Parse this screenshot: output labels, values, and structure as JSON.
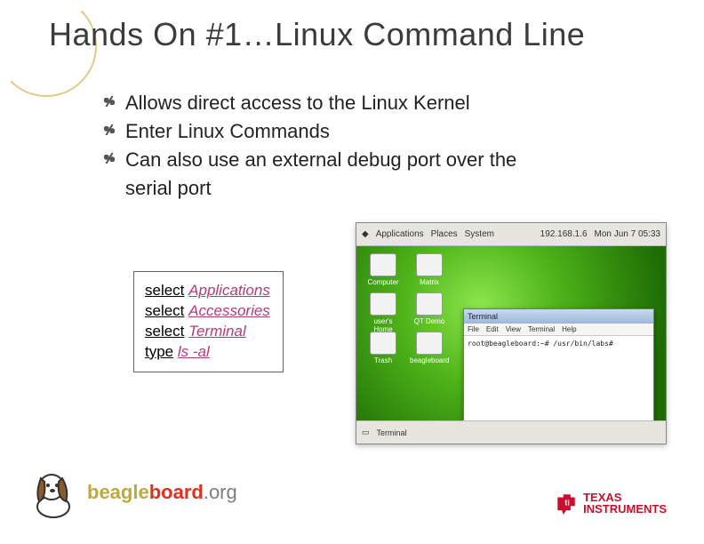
{
  "title": "Hands On #1…Linux Command Line",
  "bullets": {
    "b1": "Allows direct access to the Linux Kernel",
    "b2": "Enter Linux Commands",
    "b3a": "Can also use an external debug port over the",
    "b3b": "serial port"
  },
  "steps": {
    "s1_kw": "select",
    "s1_em": "Applications",
    "s2_kw": "select",
    "s2_em": "Accessories",
    "s3_kw": "select",
    "s3_em": "Terminal",
    "s4_kw": "type",
    "s4_em": "ls -al"
  },
  "screenshot": {
    "top_menu": {
      "m1": "Applications",
      "m2": "Places",
      "m3": "System",
      "ip": "192.168.1.6",
      "date": "Mon Jun 7  05:33"
    },
    "desk": {
      "i1": "Computer",
      "i2": "user's Home",
      "i3": "Trash",
      "i4": "Matrix",
      "i5": "QT Demo",
      "i6": "beagleboard"
    },
    "term": {
      "title": "Terminal",
      "menu": {
        "m1": "File",
        "m2": "Edit",
        "m3": "View",
        "m4": "Terminal",
        "m5": "Help"
      },
      "line": "root@beagleboard:~# /usr/bin/labs#"
    },
    "bottom": {
      "b1": "Terminal"
    }
  },
  "logos": {
    "beagle": {
      "p1": "beagle",
      "p2": "board",
      "p3": ".org"
    },
    "ti": {
      "l1": "TEXAS",
      "l2": "INSTRUMENTS"
    }
  }
}
